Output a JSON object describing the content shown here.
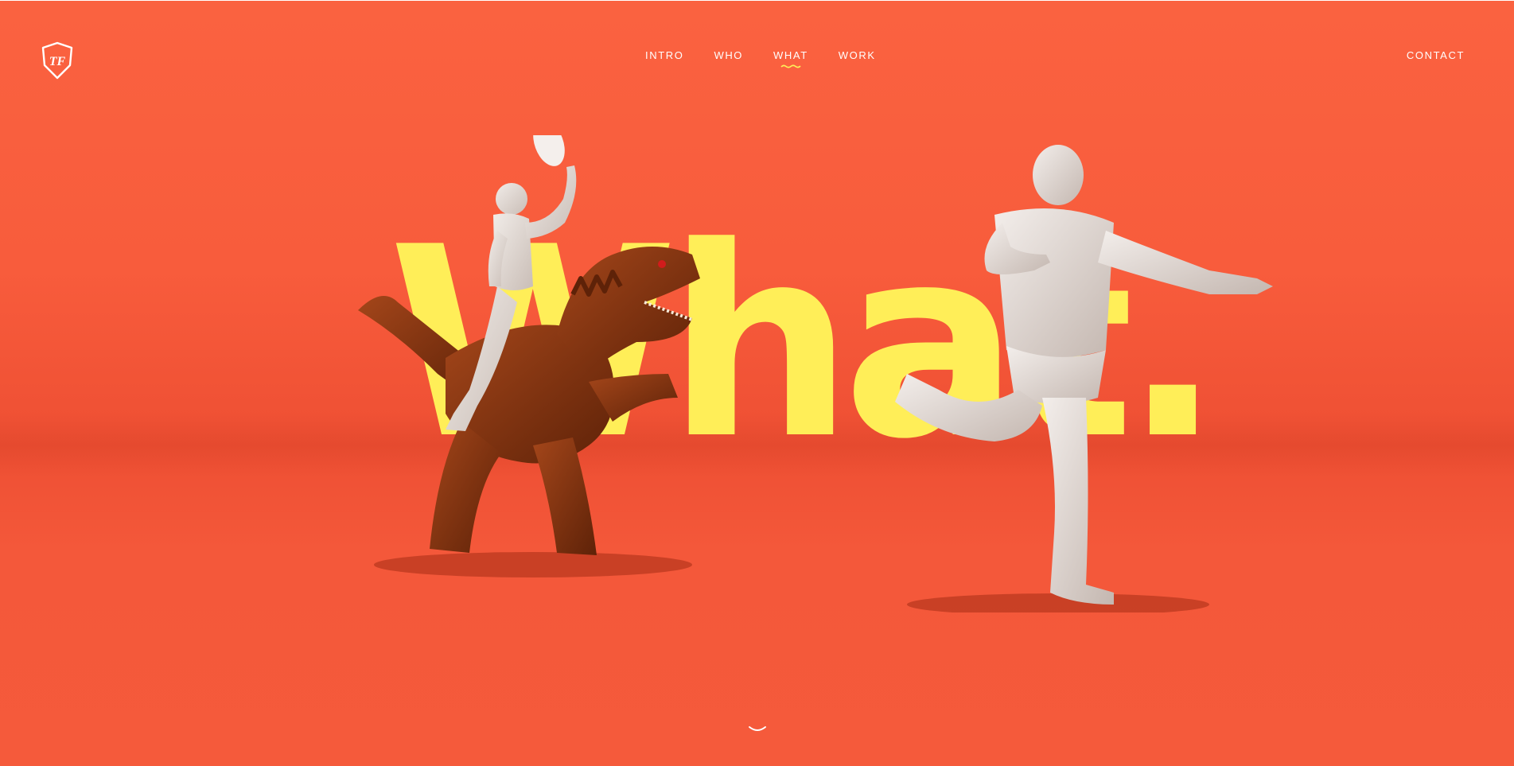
{
  "header": {
    "logo_text": "TF",
    "nav": [
      {
        "label": "INTRO",
        "active": false
      },
      {
        "label": "WHO",
        "active": false
      },
      {
        "label": "WHAT",
        "active": true
      },
      {
        "label": "WORK",
        "active": false
      }
    ],
    "contact_label": "CONTACT"
  },
  "hero": {
    "word": "What."
  },
  "icons": {
    "logo": "shield-logo-icon",
    "active_indicator": "squiggle-underline-icon",
    "scroll": "chevron-down-icon"
  },
  "colors": {
    "background": "#f3583a",
    "accent_yellow": "#ffee58",
    "text": "#ffffff",
    "dinosaur": "#8a3a14",
    "figure": "#e6dcd6"
  }
}
